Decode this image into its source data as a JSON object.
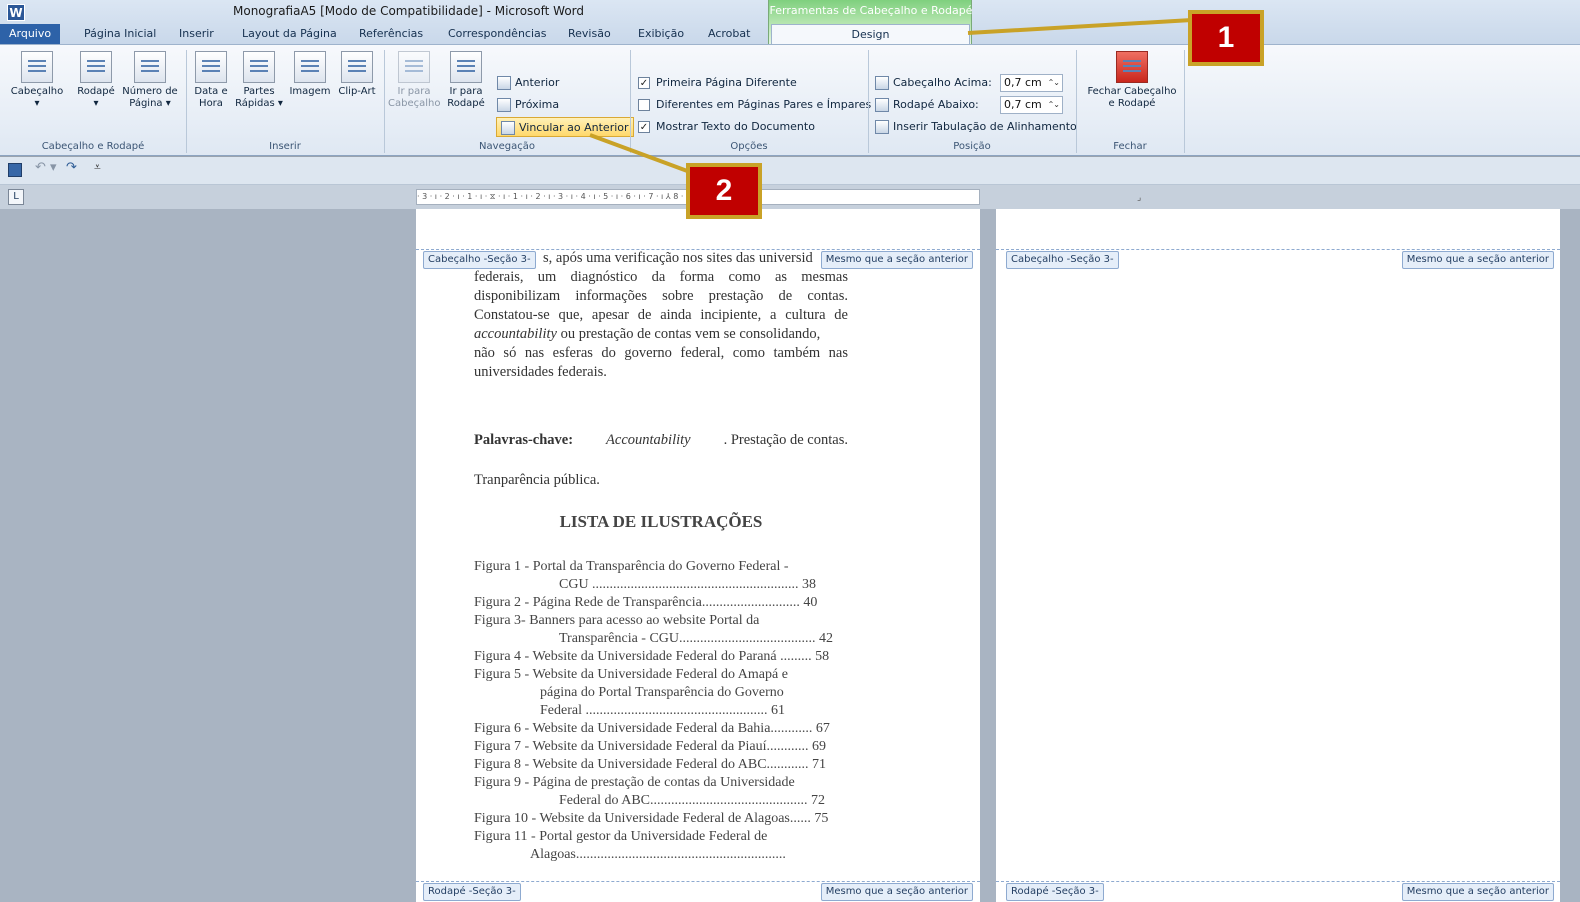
{
  "title": "MonografiaA5 [Modo de Compatibilidade] - Microsoft Word",
  "context_tab": "Ferramentas de Cabeçalho e Rodapé",
  "tabs": [
    "Arquivo",
    "Página Inicial",
    "Inserir",
    "Layout da Página",
    "Referências",
    "Correspondências",
    "Revisão",
    "Exibição",
    "Acrobat",
    "Design"
  ],
  "groups": {
    "cab": {
      "label": "Cabeçalho e Rodapé",
      "b1": "Cabeçalho",
      "b2": "Rodapé",
      "b3a": "Número de",
      "b3b": "Página"
    },
    "ins": {
      "label": "Inserir",
      "b1a": "Data e",
      "b1b": "Hora",
      "b2a": "Partes",
      "b2b": "Rápidas",
      "b3": "Imagem",
      "b4": "Clip-Art"
    },
    "nav": {
      "label": "Navegação",
      "b1a": "Ir para",
      "b1b": "Cabeçalho",
      "b2a": "Ir para",
      "b2b": "Rodapé",
      "anterior": "Anterior",
      "proxima": "Próxima",
      "vincular": "Vincular ao Anterior"
    },
    "opc": {
      "label": "Opções",
      "c1": "Primeira Página Diferente",
      "c2": "Diferentes em Páginas Pares e Ímpares",
      "c3": "Mostrar Texto do Documento"
    },
    "pos": {
      "label": "Posição",
      "r1": "Cabeçalho Acima:",
      "r2": "Rodapé Abaixo:",
      "v1": "0,7 cm",
      "v2": "0,7 cm",
      "r3": "Inserir Tabulação de Alinhamento"
    },
    "fechar": {
      "label": "Fechar",
      "b1a": "Fechar Cabeçalho",
      "b1b": "e Rodapé"
    }
  },
  "ruler_text": "· 3 · ı · 2 · ı · 1 · ı · ⧖ · ı · 1 · ı · 2 · ı · 3 · ı · 4 · ı · 5 · ı · 6 · ı · 7 · ı ⅄ 8 · ı · 9 · ı ∆10 · ı · 11 ·",
  "header_tag": "Cabeçalho -Seção 3-",
  "footer_tag": "Rodapé -Seção 3-",
  "same_as_prev": "Mesmo que a seção anterior",
  "doc": {
    "l1": "s, após uma verificação nos sites das universid",
    "l2": "federais, um diagnóstico da forma como as mesmas",
    "l3": "disponibilizam informações sobre prestação de contas.",
    "l4": "Constatou-se que, apesar de ainda incipiente, a cultura de",
    "l5a": "accountability",
    "l5b": " ou prestação de contas vem se consolidando,",
    "l6": "não só nas esferas do governo federal, como também nas",
    "l7": "universidades federais.",
    "kw_label": "Palavras-chave:",
    "kw1": "Accountability",
    "kw2": ". Prestação de contas.",
    "kw3": "Tranparência pública.",
    "heading": "LISTA DE ILUSTRAÇÕES"
  },
  "toc": [
    "Figura 1 - Portal da Transparência do Governo Federal -",
    "CGU ........................................................... 38",
    "Figura 2 - Página Rede de Transparência............................ 40",
    "Figura 3- Banners para acesso ao website Portal da",
    "Transparência - CGU....................................... 42",
    "Figura 4 - Website da Universidade Federal do Paraná ......... 58",
    "Figura 5 - Website da Universidade Federal do Amapá e",
    "página do Portal Transparência do Governo",
    "Federal .................................................... 61",
    "Figura 6 - Website da Universidade Federal da Bahia............ 67",
    "Figura 7 -  Website da Universidade Federal da Piauí............ 69",
    "Figura 8 - Website da Universidade Federal do ABC............ 71",
    "Figura 9 - Página de prestação de contas da Universidade",
    "Federal do ABC............................................. 72",
    "Figura 10 - Website da Universidade Federal de Alagoas...... 75",
    "Figura 11 - Portal gestor da Universidade Federal de",
    "Alagoas............................................................"
  ],
  "callouts": [
    "1",
    "2"
  ],
  "colors": {
    "callout_fill": "#c00000",
    "callout_border": "#c9a227",
    "context_green": "#7fd07e"
  }
}
